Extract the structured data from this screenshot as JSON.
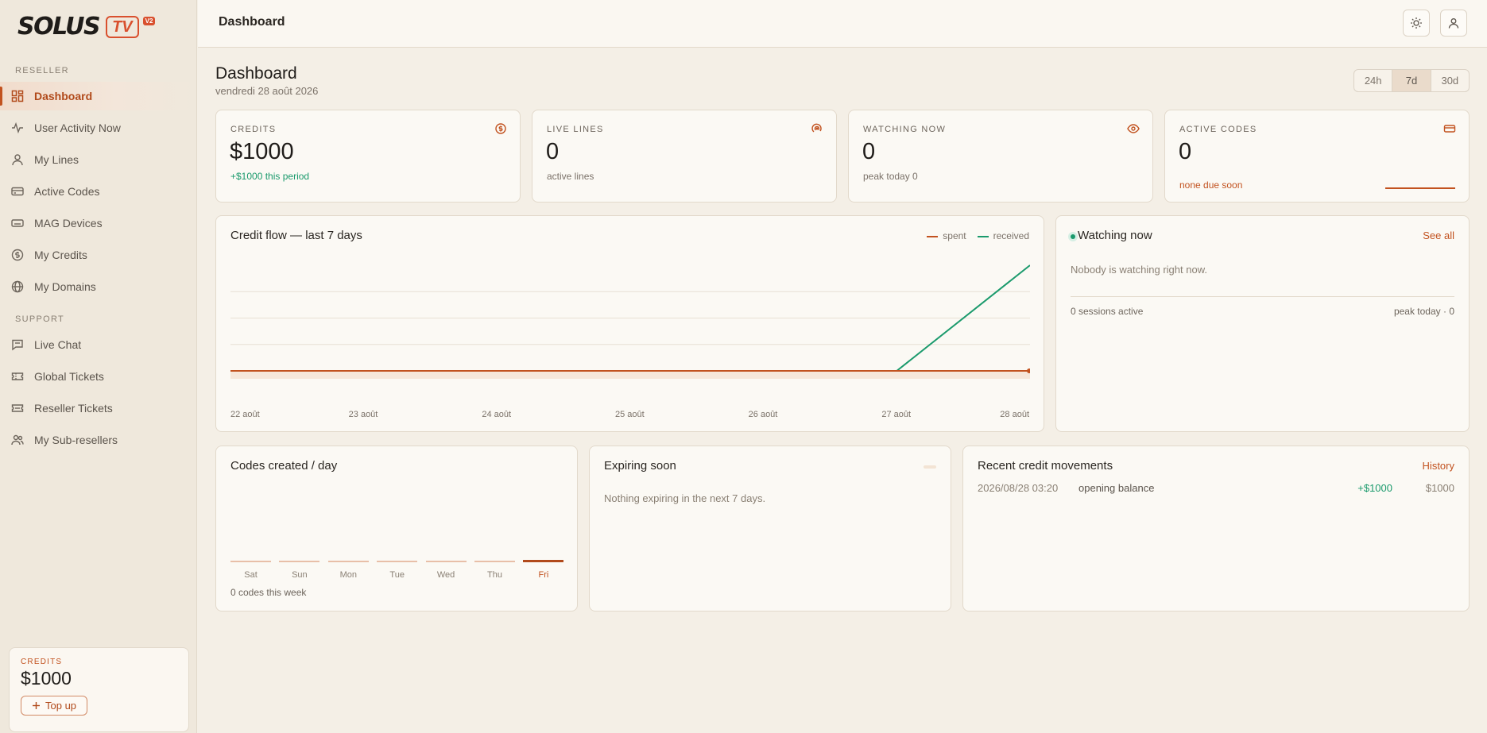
{
  "brand": {
    "name": "SOLUS",
    "badge": "TV",
    "version": "V2"
  },
  "sidebar": {
    "sections": [
      {
        "label": "RESELLER"
      },
      {
        "label": "SUPPORT"
      }
    ],
    "items": [
      {
        "label": "Dashboard",
        "icon": "dashboard-icon",
        "active": true
      },
      {
        "label": "User Activity Now",
        "icon": "activity-icon"
      },
      {
        "label": "My Lines",
        "icon": "user-icon"
      },
      {
        "label": "Active Codes",
        "icon": "card-icon"
      },
      {
        "label": "MAG Devices",
        "icon": "device-icon"
      },
      {
        "label": "My Credits",
        "icon": "dollar-coin-icon"
      },
      {
        "label": "My Domains",
        "icon": "globe-icon"
      },
      {
        "label": "Live Chat",
        "icon": "chat-icon"
      },
      {
        "label": "Global Tickets",
        "icon": "ticket-icon"
      },
      {
        "label": "Reseller Tickets",
        "icon": "ticket-icon"
      },
      {
        "label": "My Sub-resellers",
        "icon": "users-icon"
      }
    ],
    "credits": {
      "label": "CREDITS",
      "value": "$1000",
      "topup_label": "Top up"
    }
  },
  "topbar": {
    "title": "Dashboard"
  },
  "page": {
    "title": "Dashboard",
    "date": "vendredi 28 août 2026"
  },
  "range": {
    "options": [
      "24h",
      "7d",
      "30d"
    ],
    "selected": "7d"
  },
  "stats": [
    {
      "label": "CREDITS",
      "value": "$1000",
      "sub": "+$1000 this period",
      "sub_color": "#1a9a6c",
      "icon": "dollar-coin-icon"
    },
    {
      "label": "LIVE LINES",
      "value": "0",
      "sub": "active lines",
      "icon": "radio-icon"
    },
    {
      "label": "WATCHING NOW",
      "value": "0",
      "sub": "peak today 0",
      "icon": "eye-icon"
    },
    {
      "label": "ACTIVE CODES",
      "value": "0",
      "sub": "none due soon",
      "sub_color": "#c2521f",
      "icon": "card-icon"
    }
  ],
  "credit_flow": {
    "title": "Credit flow — last 7 days",
    "legend": {
      "spent": "spent",
      "received": "received"
    },
    "colors": {
      "spent": "#c2521f",
      "received": "#1a9a6c"
    }
  },
  "chart_data": {
    "type": "line",
    "title": "Credit flow — last 7 days",
    "categories": [
      "22 août",
      "23 août",
      "24 août",
      "25 août",
      "26 août",
      "27 août",
      "28 août"
    ],
    "series": [
      {
        "name": "spent",
        "values": [
          0,
          0,
          0,
          0,
          0,
          0,
          0
        ]
      },
      {
        "name": "received",
        "values": [
          0,
          0,
          0,
          0,
          0,
          0,
          1000
        ]
      }
    ],
    "ylim": [
      0,
      1000
    ],
    "grid": true,
    "legend": "top-right"
  },
  "watching": {
    "title": "Watching now",
    "see_all": "See all",
    "empty": "Nobody is watching right now.",
    "sessions": "0 sessions active",
    "peak": "peak today · 0"
  },
  "codes": {
    "title": "Codes created / day",
    "days": [
      "Sat",
      "Sun",
      "Mon",
      "Tue",
      "Wed",
      "Thu",
      "Fri"
    ],
    "values": [
      0,
      0,
      0,
      0,
      0,
      0,
      0
    ],
    "selected": "Fri",
    "summary": "0 codes this week"
  },
  "expiring": {
    "title": "Expiring soon",
    "empty": "Nothing expiring in the next 7 days."
  },
  "movements": {
    "title": "Recent credit movements",
    "history": "History",
    "rows": [
      {
        "date": "2026/08/28 03:20",
        "desc": "opening balance",
        "amount": "+$1000",
        "balance": "$1000"
      }
    ]
  }
}
